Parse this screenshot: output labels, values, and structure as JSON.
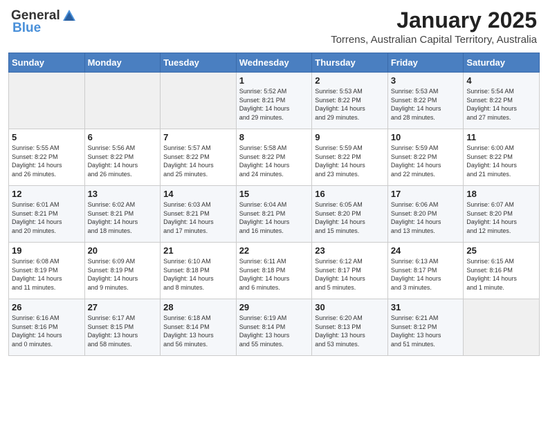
{
  "header": {
    "logo_general": "General",
    "logo_blue": "Blue",
    "month_year": "January 2025",
    "location": "Torrens, Australian Capital Territory, Australia"
  },
  "calendar": {
    "days_of_week": [
      "Sunday",
      "Monday",
      "Tuesday",
      "Wednesday",
      "Thursday",
      "Friday",
      "Saturday"
    ],
    "weeks": [
      [
        {
          "day": "",
          "info": ""
        },
        {
          "day": "",
          "info": ""
        },
        {
          "day": "",
          "info": ""
        },
        {
          "day": "1",
          "info": "Sunrise: 5:52 AM\nSunset: 8:21 PM\nDaylight: 14 hours\nand 29 minutes."
        },
        {
          "day": "2",
          "info": "Sunrise: 5:53 AM\nSunset: 8:22 PM\nDaylight: 14 hours\nand 29 minutes."
        },
        {
          "day": "3",
          "info": "Sunrise: 5:53 AM\nSunset: 8:22 PM\nDaylight: 14 hours\nand 28 minutes."
        },
        {
          "day": "4",
          "info": "Sunrise: 5:54 AM\nSunset: 8:22 PM\nDaylight: 14 hours\nand 27 minutes."
        }
      ],
      [
        {
          "day": "5",
          "info": "Sunrise: 5:55 AM\nSunset: 8:22 PM\nDaylight: 14 hours\nand 26 minutes."
        },
        {
          "day": "6",
          "info": "Sunrise: 5:56 AM\nSunset: 8:22 PM\nDaylight: 14 hours\nand 26 minutes."
        },
        {
          "day": "7",
          "info": "Sunrise: 5:57 AM\nSunset: 8:22 PM\nDaylight: 14 hours\nand 25 minutes."
        },
        {
          "day": "8",
          "info": "Sunrise: 5:58 AM\nSunset: 8:22 PM\nDaylight: 14 hours\nand 24 minutes."
        },
        {
          "day": "9",
          "info": "Sunrise: 5:59 AM\nSunset: 8:22 PM\nDaylight: 14 hours\nand 23 minutes."
        },
        {
          "day": "10",
          "info": "Sunrise: 5:59 AM\nSunset: 8:22 PM\nDaylight: 14 hours\nand 22 minutes."
        },
        {
          "day": "11",
          "info": "Sunrise: 6:00 AM\nSunset: 8:22 PM\nDaylight: 14 hours\nand 21 minutes."
        }
      ],
      [
        {
          "day": "12",
          "info": "Sunrise: 6:01 AM\nSunset: 8:21 PM\nDaylight: 14 hours\nand 20 minutes."
        },
        {
          "day": "13",
          "info": "Sunrise: 6:02 AM\nSunset: 8:21 PM\nDaylight: 14 hours\nand 18 minutes."
        },
        {
          "day": "14",
          "info": "Sunrise: 6:03 AM\nSunset: 8:21 PM\nDaylight: 14 hours\nand 17 minutes."
        },
        {
          "day": "15",
          "info": "Sunrise: 6:04 AM\nSunset: 8:21 PM\nDaylight: 14 hours\nand 16 minutes."
        },
        {
          "day": "16",
          "info": "Sunrise: 6:05 AM\nSunset: 8:20 PM\nDaylight: 14 hours\nand 15 minutes."
        },
        {
          "day": "17",
          "info": "Sunrise: 6:06 AM\nSunset: 8:20 PM\nDaylight: 14 hours\nand 13 minutes."
        },
        {
          "day": "18",
          "info": "Sunrise: 6:07 AM\nSunset: 8:20 PM\nDaylight: 14 hours\nand 12 minutes."
        }
      ],
      [
        {
          "day": "19",
          "info": "Sunrise: 6:08 AM\nSunset: 8:19 PM\nDaylight: 14 hours\nand 11 minutes."
        },
        {
          "day": "20",
          "info": "Sunrise: 6:09 AM\nSunset: 8:19 PM\nDaylight: 14 hours\nand 9 minutes."
        },
        {
          "day": "21",
          "info": "Sunrise: 6:10 AM\nSunset: 8:18 PM\nDaylight: 14 hours\nand 8 minutes."
        },
        {
          "day": "22",
          "info": "Sunrise: 6:11 AM\nSunset: 8:18 PM\nDaylight: 14 hours\nand 6 minutes."
        },
        {
          "day": "23",
          "info": "Sunrise: 6:12 AM\nSunset: 8:17 PM\nDaylight: 14 hours\nand 5 minutes."
        },
        {
          "day": "24",
          "info": "Sunrise: 6:13 AM\nSunset: 8:17 PM\nDaylight: 14 hours\nand 3 minutes."
        },
        {
          "day": "25",
          "info": "Sunrise: 6:15 AM\nSunset: 8:16 PM\nDaylight: 14 hours\nand 1 minute."
        }
      ],
      [
        {
          "day": "26",
          "info": "Sunrise: 6:16 AM\nSunset: 8:16 PM\nDaylight: 14 hours\nand 0 minutes."
        },
        {
          "day": "27",
          "info": "Sunrise: 6:17 AM\nSunset: 8:15 PM\nDaylight: 13 hours\nand 58 minutes."
        },
        {
          "day": "28",
          "info": "Sunrise: 6:18 AM\nSunset: 8:14 PM\nDaylight: 13 hours\nand 56 minutes."
        },
        {
          "day": "29",
          "info": "Sunrise: 6:19 AM\nSunset: 8:14 PM\nDaylight: 13 hours\nand 55 minutes."
        },
        {
          "day": "30",
          "info": "Sunrise: 6:20 AM\nSunset: 8:13 PM\nDaylight: 13 hours\nand 53 minutes."
        },
        {
          "day": "31",
          "info": "Sunrise: 6:21 AM\nSunset: 8:12 PM\nDaylight: 13 hours\nand 51 minutes."
        },
        {
          "day": "",
          "info": ""
        }
      ]
    ]
  }
}
